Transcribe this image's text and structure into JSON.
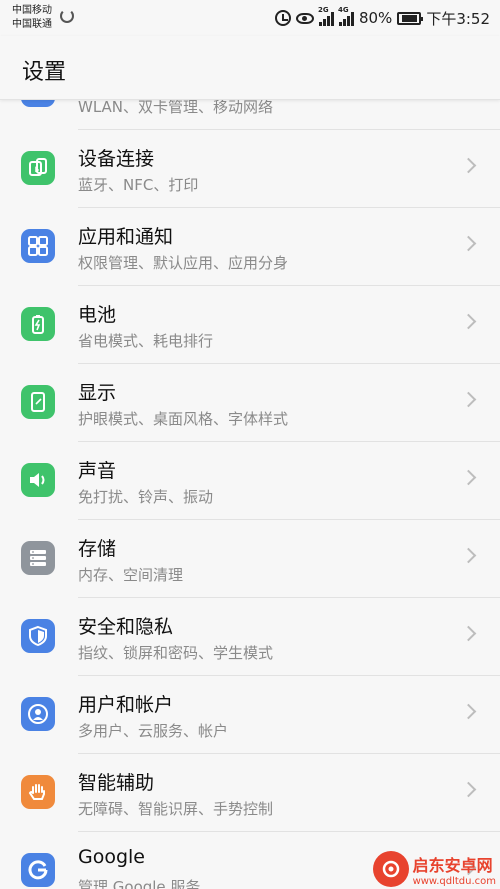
{
  "status_bar": {
    "carrier_1": "中国移动",
    "carrier_2": "中国联通",
    "net_1": "2G",
    "net_2": "4G",
    "battery": "80%",
    "battery_level": 0.8,
    "time": "下午3:52",
    "icons": [
      "alarm-icon",
      "eye-comfort-icon",
      "signal-icon",
      "battery-icon"
    ]
  },
  "header": {
    "title": "设置"
  },
  "colors": {
    "blue": "#4a82e4",
    "green": "#3fc36b",
    "gray": "#8f959c",
    "orange": "#f08a3c",
    "chevron": "#bdbdbd",
    "subtitle": "#8a8a8a"
  },
  "items": [
    {
      "title": "",
      "subtitle": "WLAN、双卡管理、移动网络",
      "icon": "network-icon",
      "color": "#4a82e4"
    },
    {
      "title": "设备连接",
      "subtitle": "蓝牙、NFC、打印",
      "icon": "device-connection-icon",
      "color": "#3fc36b"
    },
    {
      "title": "应用和通知",
      "subtitle": "权限管理、默认应用、应用分身",
      "icon": "apps-grid-icon",
      "color": "#4a82e4"
    },
    {
      "title": "电池",
      "subtitle": "省电模式、耗电排行",
      "icon": "battery-icon",
      "color": "#3fc36b"
    },
    {
      "title": "显示",
      "subtitle": "护眼模式、桌面风格、字体样式",
      "icon": "display-icon",
      "color": "#3fc36b"
    },
    {
      "title": "声音",
      "subtitle": "免打扰、铃声、振动",
      "icon": "speaker-icon",
      "color": "#3fc36b"
    },
    {
      "title": "存储",
      "subtitle": "内存、空间清理",
      "icon": "storage-icon",
      "color": "#8f959c"
    },
    {
      "title": "安全和隐私",
      "subtitle": "指纹、锁屏和密码、学生模式",
      "icon": "shield-icon",
      "color": "#4a82e4"
    },
    {
      "title": "用户和帐户",
      "subtitle": "多用户、云服务、帐户",
      "icon": "user-icon",
      "color": "#4a82e4"
    },
    {
      "title": "智能辅助",
      "subtitle": "无障碍、智能识屏、手势控制",
      "icon": "hand-icon",
      "color": "#f08a3c"
    },
    {
      "title": "Google",
      "subtitle": "管理 Google 服务",
      "icon": "google-icon",
      "color": "#4a82e4"
    }
  ],
  "watermark": {
    "title": "启东安卓网",
    "url": "www.qdltdu.com"
  }
}
